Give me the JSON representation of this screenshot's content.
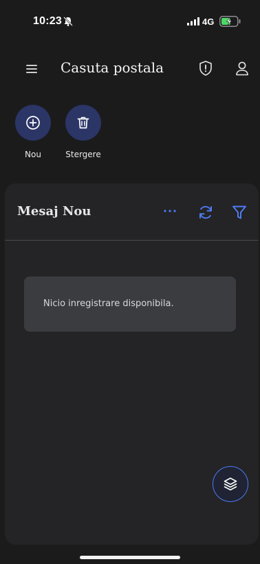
{
  "status_bar": {
    "time": "10:23",
    "network": "4G",
    "icons": [
      "bell-muted-icon",
      "signal-icon",
      "battery-charging-icon"
    ]
  },
  "header": {
    "title": "Casuta postala",
    "icons": [
      "menu-icon",
      "shield-alert-icon",
      "user-icon"
    ]
  },
  "quick_actions": [
    {
      "label": "Nou",
      "icon": "plus-circle-icon"
    },
    {
      "label": "Stergere",
      "icon": "trash-icon"
    }
  ],
  "panel": {
    "title": "Mesaj Nou",
    "icons": [
      "more-icon",
      "refresh-icon",
      "filter-icon"
    ],
    "empty_message": "Nicio inregistrare disponibila."
  },
  "fab": {
    "icon": "layers-icon"
  },
  "colors": {
    "background": "#1b1b1c",
    "panel": "#242426",
    "accent": "#4d7bf3",
    "action_circle": "#2b3566",
    "empty_box": "#3a3c40",
    "battery": "#4cd964"
  }
}
